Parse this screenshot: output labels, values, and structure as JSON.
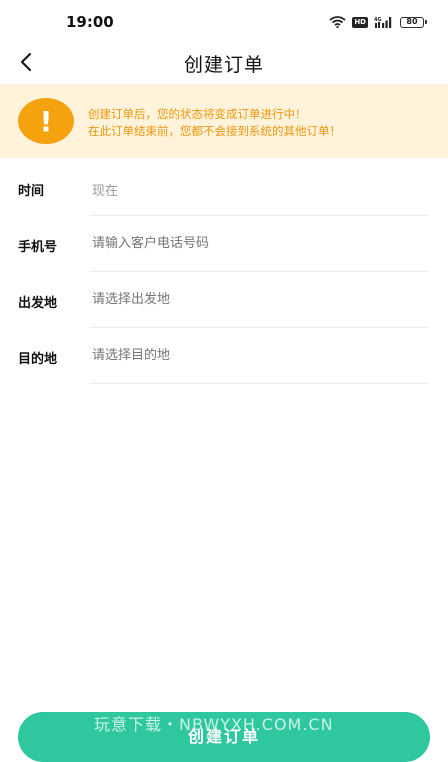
{
  "status_bar": {
    "time": "19:00",
    "hd_label": "HD",
    "network_label": "4G",
    "battery_level": "80"
  },
  "nav": {
    "title": "创建订单"
  },
  "notice": {
    "line1": "创建订单后，您的状态将变成订单进行中！",
    "line2": "在此订单结束前，您都不会接到系统的其他订单！",
    "icon_glyph": "!"
  },
  "form": {
    "rows": [
      {
        "label": "时间",
        "value": "现在",
        "placeholder": ""
      },
      {
        "label": "手机号",
        "value": "",
        "placeholder": "请输入客户电话号码"
      },
      {
        "label": "出发地",
        "value": "",
        "placeholder": "请选择出发地"
      },
      {
        "label": "目的地",
        "value": "",
        "placeholder": "请选择目的地"
      }
    ]
  },
  "submit": {
    "label": "创建订单"
  },
  "watermark": "玩意下载・NBWYXH.COM.CN",
  "colors": {
    "accent": "#2fc7a0",
    "warning": "#f5a20f",
    "notice_bg": "#fff3dc"
  }
}
